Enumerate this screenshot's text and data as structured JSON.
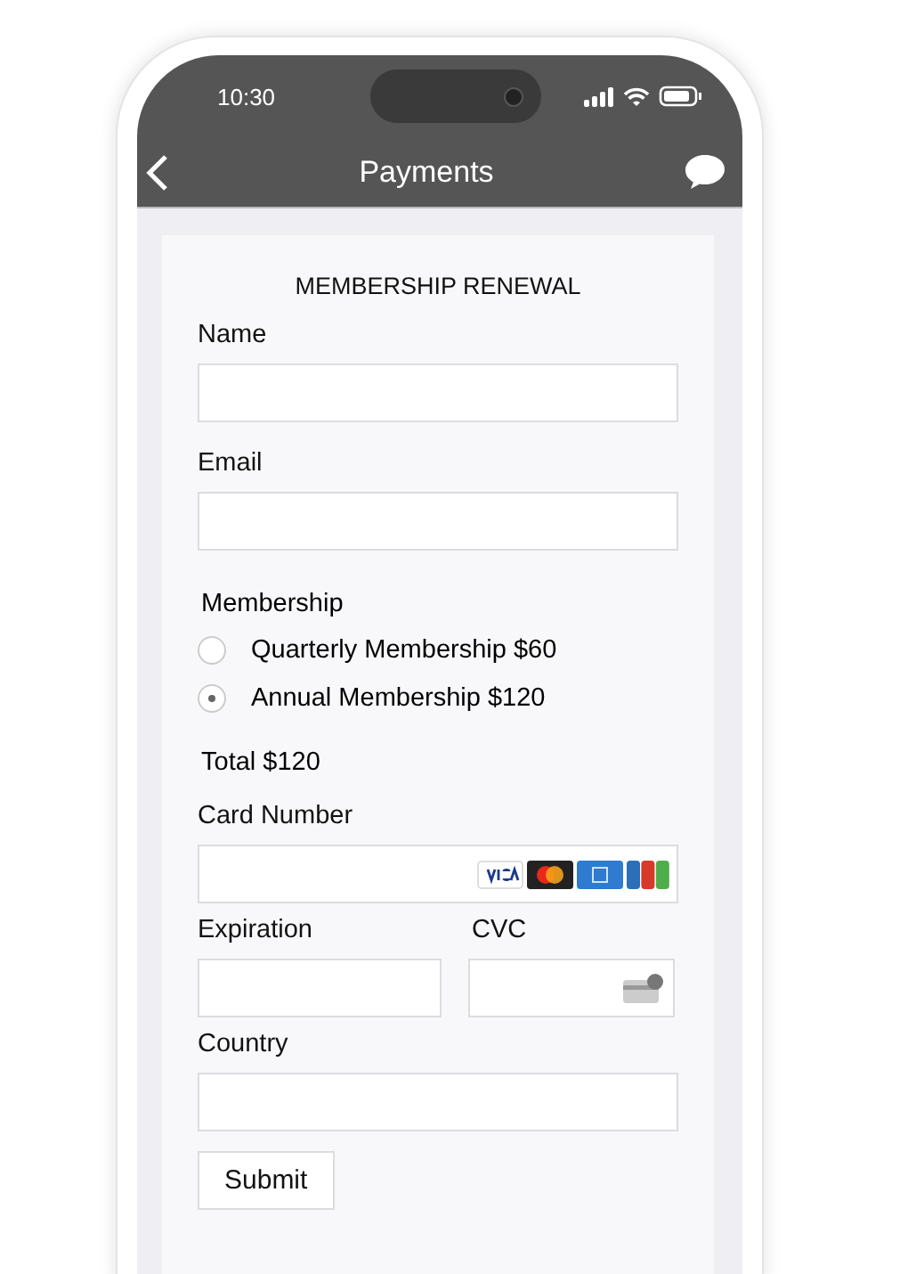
{
  "status_bar": {
    "time": "10:30"
  },
  "header": {
    "title": "Payments"
  },
  "form": {
    "title": "MEMBERSHIP RENEWAL",
    "fields": [
      {
        "label": "Name"
      },
      {
        "label": "Email"
      }
    ],
    "membership": {
      "label": "Membership",
      "options": [
        {
          "label": "Quarterly Membership $60",
          "selected": false
        },
        {
          "label": "Annual Membership $120",
          "selected": true
        }
      ]
    },
    "total": "Total $120",
    "card_number": {
      "label": "Card Number"
    },
    "expiration": {
      "label": "Expiration"
    },
    "cvc": {
      "label": "CVC"
    },
    "country": {
      "label": "Country"
    },
    "submit": "Submit"
  }
}
